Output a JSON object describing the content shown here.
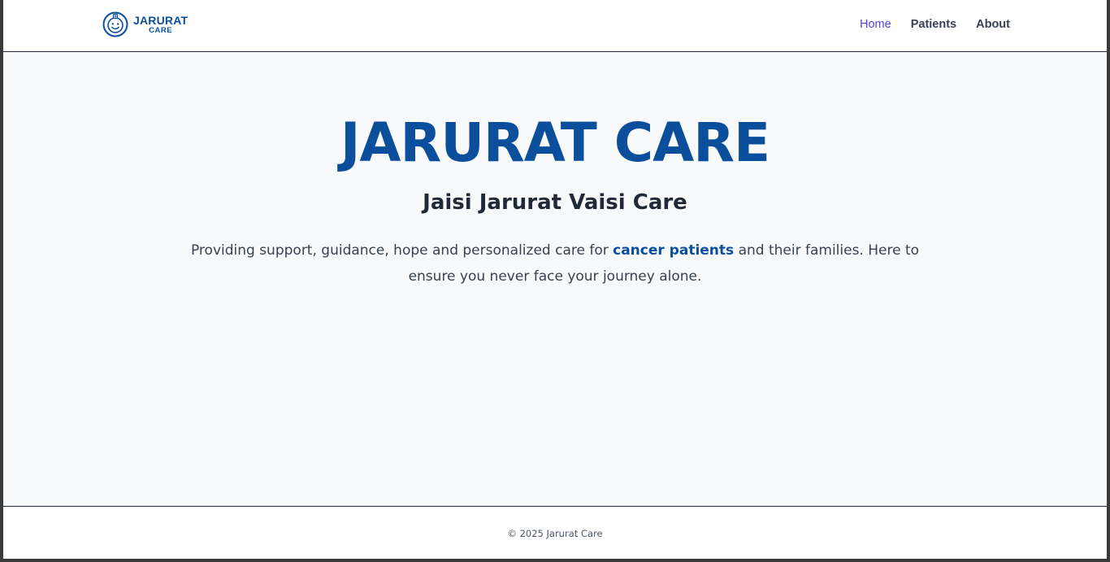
{
  "brand": {
    "logo_title": "JARURAT",
    "logo_subtitle": "CARE",
    "logo_icon": "smiling-doctor-icon",
    "accent_color": "#0b4f9c"
  },
  "nav": {
    "items": [
      {
        "label": "Home",
        "active": true
      },
      {
        "label": "Patients",
        "active": false
      },
      {
        "label": "About",
        "active": false
      }
    ],
    "active_color": "#4f46e5"
  },
  "hero": {
    "title": "JARURAT CARE",
    "subtitle": "Jaisi Jarurat Vaisi Care",
    "description_before": "Providing support, guidance, hope and personalized care for ",
    "description_highlight": "cancer patients",
    "description_after": " and their families. Here to ensure you never face your journey alone."
  },
  "footer": {
    "copyright": "© 2025 Jarurat Care"
  }
}
